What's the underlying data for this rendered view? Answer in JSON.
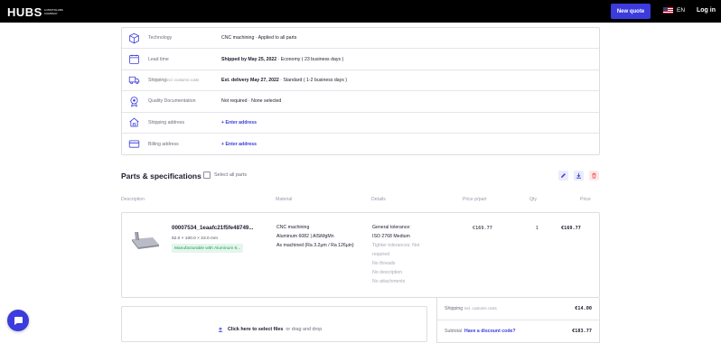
{
  "header": {
    "logo": "HUBS",
    "logo_sub": "A PROTOLABS COMPANY",
    "new_quote": "New quote",
    "language": "EN",
    "login": "Log in"
  },
  "order_info": {
    "rows": [
      {
        "icon": "cube-icon",
        "label": "Technology",
        "label_small": "",
        "value_bold": "",
        "value": "CNC machining · Applied to all parts",
        "link": ""
      },
      {
        "icon": "clock-icon",
        "label": "Lead time",
        "label_small": "",
        "value_bold": "Shipped by May 25, 2022",
        "value": " · Economy ( 23 business days )",
        "link": ""
      },
      {
        "icon": "truck-icon",
        "label": "Shipping",
        "label_small": "incl. customs costs",
        "value_bold": "Est. delivery May 27, 2022",
        "value": " · Standard ( 1-2 business days )",
        "link": ""
      },
      {
        "icon": "badge-icon",
        "label": "Quality Documentation",
        "label_small": "",
        "value_bold": "",
        "value": "Not required · None selected",
        "link": ""
      },
      {
        "icon": "home-icon",
        "label": "Shipping address",
        "label_small": "",
        "value_bold": "",
        "value": "",
        "link": "+  Enter address"
      },
      {
        "icon": "card-icon",
        "label": "Billing address",
        "label_small": "",
        "value_bold": "",
        "value": "",
        "link": "+  Enter address"
      }
    ]
  },
  "parts": {
    "title": "Parts & specifications",
    "select_all": "Select all parts",
    "columns": {
      "description": "Description",
      "material": "Material",
      "details": "Details",
      "price_per_part": "Price p/part",
      "qty": "Qty",
      "price": "Price"
    },
    "items": [
      {
        "name": "00007534_1eaafc21f5fe48749...",
        "dims": "52.0 × 100.0 × 23.0 mm",
        "badge": "Manufacturable with Aluminum 6...",
        "material": [
          "CNC machining",
          "Aluminum 6082 | AlSiMgMn",
          "As machined (Ra 3.2μm / Ra 126μin)"
        ],
        "details_dark": [
          "General tolerance:",
          "ISO 2768 Medium"
        ],
        "details_muted": [
          "Tighter tolerances: Not",
          "required",
          "No threads",
          "No description",
          "No attachments"
        ],
        "price_per_part": "€169.77",
        "qty": "1",
        "price": "€169.77"
      }
    ]
  },
  "upload": {
    "bold": "Click here to select files",
    "rest": "or drag and drop"
  },
  "summary": {
    "shipping_label": "Shipping",
    "shipping_small": "incl. customs costs",
    "shipping_value": "€14.00",
    "subtotal_label": "Subtotal",
    "discount_link": "Have a discount code?",
    "subtotal_value": "€183.77"
  },
  "colors": {
    "accent": "#3b3bde",
    "success": "#18a058",
    "danger": "#e5484d"
  }
}
